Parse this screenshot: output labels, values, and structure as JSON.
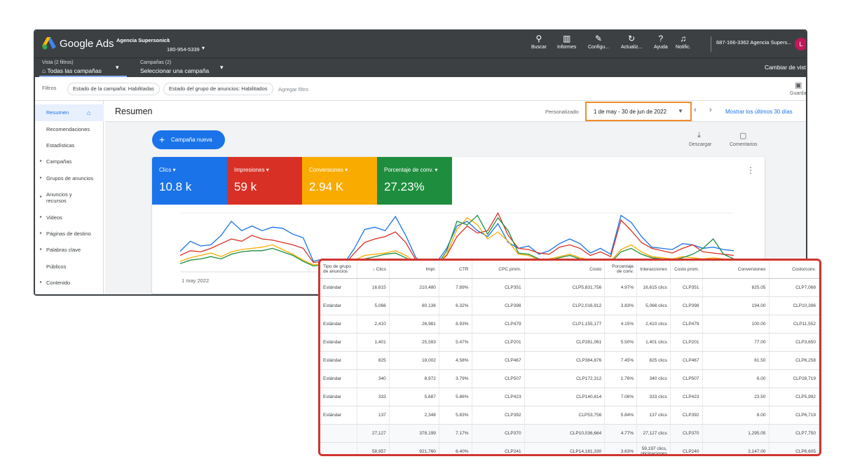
{
  "topbar": {
    "brand": "Google Ads",
    "account_name": "Agencia Supersonics",
    "account_id": "180-954-5339",
    "tools": [
      {
        "icon": "search-icon",
        "label": "Buscar"
      },
      {
        "icon": "reports-icon",
        "label": "Informes"
      },
      {
        "icon": "wrench-icon",
        "label": "Configu..."
      },
      {
        "icon": "refresh-icon",
        "label": "Actualiz..."
      },
      {
        "icon": "help-icon",
        "label": "Ayuda"
      },
      {
        "icon": "bell-icon",
        "label": "Notific."
      }
    ],
    "customer_account": "687-166-3362 Agencia Supers...",
    "avatar_letter": "L"
  },
  "viewbar": {
    "view_label": "Vista (2 filtros)",
    "view_value": "Todas las campañas",
    "campaigns_label": "Campañas (2)",
    "campaigns_value": "Seleccionar una campaña",
    "change_view": "Cambiar de vist"
  },
  "filterbar": {
    "label": "Filtros",
    "chips": [
      "Estado de la campaña: Habilitadas",
      "Estado del grupo de anuncios: Habilitados"
    ],
    "add_filter": "Agregar filtro",
    "save_label": "Guarda"
  },
  "sidebar": {
    "items": [
      {
        "label": "Resumen",
        "arrow": ""
      },
      {
        "label": "Recomendaciones",
        "arrow": ""
      },
      {
        "label": "Estadísticas",
        "arrow": ""
      },
      {
        "label": "Campañas",
        "arrow": "▸"
      },
      {
        "label": "Grupos de anuncios",
        "arrow": "▸"
      },
      {
        "label": "Anuncios y",
        "label2": "recursos",
        "arrow": "▸"
      },
      {
        "label": "Videos",
        "arrow": "▸"
      },
      {
        "label": "Páginas de destino",
        "arrow": "▸"
      },
      {
        "label": "Palabras clave",
        "arrow": "▸"
      },
      {
        "label": "Públicos",
        "arrow": ""
      },
      {
        "label": "Contenido",
        "arrow": "▸"
      }
    ]
  },
  "main": {
    "title": "Resumen",
    "date_custom": "Personalizado",
    "date_range": "1 de may - 30 de jun de 2022",
    "show_last": "Mostrar los últimos 30 días",
    "new_campaign": "Campaña nueva",
    "download": "Descargar",
    "comments": "Comentarios"
  },
  "metrics": [
    {
      "label": "Clics",
      "value": "10.8 k",
      "color": "#1a73e8"
    },
    {
      "label": "Impresiones",
      "value": "59 k",
      "color": "#d93025"
    },
    {
      "label": "Conversiones",
      "value": "2.94 K",
      "color": "#f9ab00"
    },
    {
      "label": "Porcentaje de conv.",
      "value": "27.23%",
      "color": "#1e8e3e"
    }
  ],
  "chart_data": {
    "type": "line",
    "x_start_label": "1 may 2022",
    "series": [
      {
        "color": "#1a73e8",
        "values": [
          0.35,
          0.52,
          0.44,
          0.46,
          0.62,
          0.86,
          0.7,
          0.78,
          0.7,
          0.76,
          0.74,
          0.64,
          0.58,
          0.18,
          0.22,
          0.1,
          0.14,
          0.4,
          0.72,
          0.76,
          0.7,
          0.94,
          0.62,
          0.24,
          0.12,
          0.16,
          0.4,
          0.78,
          0.86,
          0.7,
          0.6,
          0.82,
          0.5,
          0.4,
          0.44,
          0.3,
          0.36,
          0.48,
          0.56,
          0.48,
          0.32,
          0.4,
          0.3,
          0.96,
          0.84,
          0.6,
          0.42,
          0.4,
          0.38,
          0.48,
          0.46,
          0.4,
          0.42,
          0.38,
          0.36
        ]
      },
      {
        "color": "#d93025",
        "values": [
          0.28,
          0.36,
          0.34,
          0.4,
          0.48,
          0.56,
          0.52,
          0.62,
          0.56,
          0.54,
          0.5,
          0.46,
          0.4,
          0.16,
          0.18,
          0.1,
          0.12,
          0.32,
          0.5,
          0.56,
          0.6,
          0.68,
          0.5,
          0.2,
          0.1,
          0.12,
          0.28,
          0.6,
          0.78,
          0.66,
          0.7,
          1.0,
          0.62,
          0.4,
          0.38,
          0.32,
          0.3,
          0.42,
          0.46,
          0.4,
          0.28,
          0.34,
          0.26,
          0.88,
          0.7,
          0.5,
          0.4,
          0.36,
          0.32,
          0.4,
          0.46,
          0.34,
          0.32,
          0.3,
          0.28
        ]
      },
      {
        "color": "#f9ab00",
        "values": [
          0.18,
          0.24,
          0.28,
          0.32,
          0.26,
          0.34,
          0.38,
          0.4,
          0.42,
          0.46,
          0.38,
          0.3,
          0.2,
          0.12,
          0.14,
          0.08,
          0.1,
          0.2,
          0.28,
          0.3,
          0.32,
          0.36,
          0.28,
          0.16,
          0.1,
          0.12,
          0.3,
          0.72,
          0.92,
          0.8,
          0.56,
          0.68,
          0.52,
          0.3,
          0.28,
          0.2,
          0.22,
          0.26,
          0.3,
          0.24,
          0.2,
          0.22,
          0.18,
          0.38,
          0.46,
          0.34,
          0.26,
          0.24,
          0.22,
          0.26,
          0.24,
          0.22,
          0.24,
          0.22,
          0.2
        ]
      },
      {
        "color": "#1e8e3e",
        "values": [
          0.14,
          0.2,
          0.22,
          0.26,
          0.22,
          0.3,
          0.34,
          0.36,
          0.36,
          0.4,
          0.34,
          0.28,
          0.18,
          0.1,
          0.12,
          0.06,
          0.08,
          0.16,
          0.22,
          0.26,
          0.3,
          0.32,
          0.24,
          0.14,
          0.08,
          0.1,
          0.36,
          0.86,
          0.8,
          0.96,
          0.64,
          0.92,
          0.7,
          0.32,
          0.3,
          0.22,
          0.2,
          0.24,
          0.28,
          0.22,
          0.18,
          0.2,
          0.16,
          0.34,
          0.4,
          0.3,
          0.24,
          0.22,
          0.2,
          0.24,
          0.3,
          0.4,
          0.56,
          0.3,
          0.22
        ]
      }
    ]
  },
  "table": {
    "headers": [
      "Tipo de grupo de anuncios",
      "↓ Clics",
      "Impr.",
      "CTR",
      "CPC prom.",
      "Costo",
      "Porcentaje de conv.",
      "Interacciones",
      "Costo prom.",
      "Conversiones",
      "Costo/conv."
    ],
    "rows": [
      [
        "Estándar",
        "16,615",
        "210,480",
        "7.89%",
        "CLP351",
        "CLP5,831,756",
        "4.97%",
        "16,615 clics",
        "CLP351",
        "825.05",
        "CLP7,068"
      ],
      [
        "Estándar",
        "5,066",
        "80,136",
        "6.32%",
        "CLP398",
        "CLP2,016,912",
        "3.83%",
        "5,066 clics",
        "CLP398",
        "194.00",
        "CLP10,396"
      ],
      [
        "Estándar",
        "2,410",
        "26,981",
        "8.93%",
        "CLP479",
        "CLP1,155,177",
        "4.15%",
        "2,410 clics",
        "CLP479",
        "100.00",
        "CLP11,552"
      ],
      [
        "Estándar",
        "1,401",
        "25,593",
        "5.47%",
        "CLP201",
        "CLP281,061",
        "5.50%",
        "1,401 clics",
        "CLP201",
        "77.00",
        "CLP3,650"
      ],
      [
        "Estándar",
        "825",
        "18,002",
        "4.58%",
        "CLP467",
        "CLP384,876",
        "7.45%",
        "825 clics",
        "CLP467",
        "61.50",
        "CLP6,258"
      ],
      [
        "Estándar",
        "340",
        "8,972",
        "3.79%",
        "CLP507",
        "CLP172,312",
        "1.76%",
        "340 clics",
        "CLP507",
        "6.00",
        "CLP28,719"
      ],
      [
        "Estándar",
        "333",
        "5,687",
        "5.86%",
        "CLP423",
        "CLP140,814",
        "7.06%",
        "333 clics",
        "CLP423",
        "23.50",
        "CLP5,992"
      ],
      [
        "Estándar",
        "137",
        "2,348",
        "5.83%",
        "CLP392",
        "CLP53,756",
        "5.84%",
        "137 clics",
        "CLP392",
        "8.00",
        "CLP6,719"
      ]
    ],
    "totals": [
      [
        "",
        "27,127",
        "378,199",
        "7.17%",
        "CLP370",
        "CLP10,036,664",
        "4.77%",
        "27,127 clics",
        "CLP370",
        "1,295.05",
        "CLP7,750"
      ],
      [
        "",
        "58,957",
        "921,760",
        "6.40%",
        "CLP241",
        "CLP14,181,330",
        "3.63%",
        "59,197 clics, nticipaciones",
        "CLP240",
        "2,147.00",
        "CLP6,605"
      ]
    ]
  }
}
